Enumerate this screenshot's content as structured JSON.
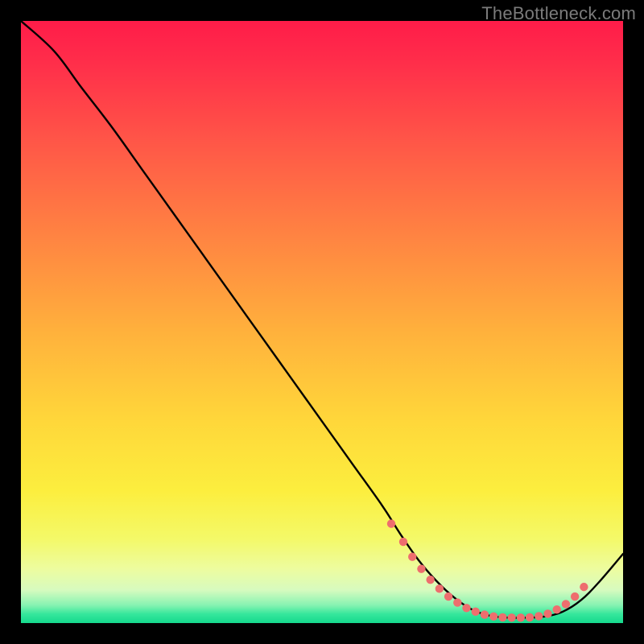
{
  "watermark": "TheBottleneck.com",
  "gradient_stops": [
    {
      "offset": 0.0,
      "color": "#ff1c49"
    },
    {
      "offset": 0.07,
      "color": "#ff2e4a"
    },
    {
      "offset": 0.22,
      "color": "#ff5c47"
    },
    {
      "offset": 0.38,
      "color": "#ff8a41"
    },
    {
      "offset": 0.52,
      "color": "#ffb23c"
    },
    {
      "offset": 0.66,
      "color": "#ffd63a"
    },
    {
      "offset": 0.78,
      "color": "#fcee3e"
    },
    {
      "offset": 0.86,
      "color": "#f4f968"
    },
    {
      "offset": 0.91,
      "color": "#edfc9f"
    },
    {
      "offset": 0.945,
      "color": "#d7fbbf"
    },
    {
      "offset": 0.97,
      "color": "#88f3b2"
    },
    {
      "offset": 0.985,
      "color": "#36e79c"
    },
    {
      "offset": 1.0,
      "color": "#15d98d"
    }
  ],
  "chart_data": {
    "type": "line",
    "title": "",
    "xlabel": "",
    "ylabel": "",
    "xlim": [
      0,
      100
    ],
    "ylim": [
      0,
      100
    ],
    "series": [
      {
        "name": "curve",
        "x": [
          0,
          5.5,
          10,
          15,
          20,
          25,
          30,
          35,
          40,
          45,
          50,
          55,
          60,
          63,
          66,
          69,
          72,
          75,
          78,
          81,
          84,
          87,
          90,
          93,
          96,
          100
        ],
        "y": [
          100,
          95,
          89,
          82.5,
          75.5,
          68.5,
          61.5,
          54.5,
          47.5,
          40.5,
          33.5,
          26.5,
          19.5,
          14.8,
          10.5,
          7.0,
          4.2,
          2.2,
          1.2,
          0.9,
          0.9,
          1.1,
          1.9,
          3.8,
          6.8,
          11.5
        ]
      }
    ],
    "markers": {
      "name": "dots",
      "x": [
        61.5,
        63.5,
        65,
        66.5,
        68,
        69.5,
        71,
        72.5,
        74,
        75.5,
        77,
        78.5,
        80,
        81.5,
        83,
        84.5,
        86,
        87.5,
        89,
        90.5,
        92,
        93.5
      ],
      "y": [
        16.5,
        13.5,
        11,
        9.0,
        7.2,
        5.7,
        4.4,
        3.4,
        2.5,
        1.9,
        1.4,
        1.1,
        0.95,
        0.9,
        0.9,
        0.95,
        1.15,
        1.55,
        2.25,
        3.15,
        4.4,
        6.0
      ]
    },
    "marker_color": "#ee6e6e",
    "line_color": "#000000"
  }
}
